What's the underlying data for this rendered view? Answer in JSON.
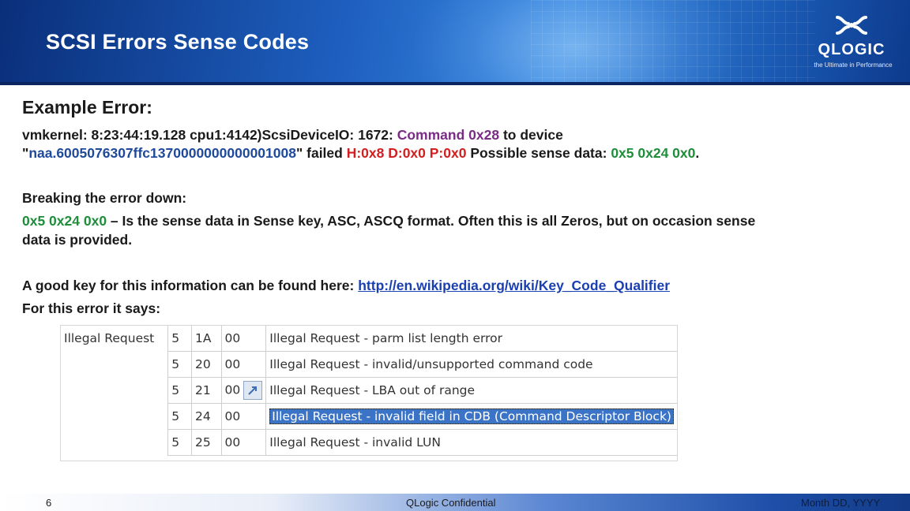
{
  "slide": {
    "title": "SCSI Errors Sense Codes",
    "logo": {
      "word": "QLOGIC",
      "tagline": "the Ultimate in Performance"
    },
    "heading": "Example Error:",
    "error_line1": {
      "prefix": "vmkernel: 8:23:44:19.128 cpu1:4142)ScsiDeviceIO: 1672: ",
      "command": "Command 0x28",
      "suffix": " to device"
    },
    "error_line2": {
      "open_quote": "\"",
      "device": "naa.6005076307ffc1370000000000001008",
      "failed": "\" failed ",
      "hdp": "H:0x8 D:0x0 P:0x0",
      "sense_label": " Possible sense data: ",
      "sense": "0x5 0x24 0x0",
      "end": "."
    },
    "breaking": "Breaking the error down:",
    "explain": {
      "sense": "0x5 0x24 0x0",
      "text1": " – Is the sense data in Sense key, ASC,  ASCQ format.  Often this is all Zeros, but on occasion sense",
      "text2": "data is provided."
    },
    "key_line": {
      "text": "A good key for this information can be found here: ",
      "link": "http://en.wikipedia.org/wiki/Key_Code_Qualifier"
    },
    "says": "For this error it says:",
    "table": {
      "category": "Illegal Request",
      "rows": [
        {
          "sk": "5",
          "asc": "1A",
          "ascq": "00",
          "desc": "Illegal Request - parm list length error"
        },
        {
          "sk": "5",
          "asc": "20",
          "ascq": "00",
          "desc": "Illegal Request - invalid/unsupported command code"
        },
        {
          "sk": "5",
          "asc": "21",
          "ascq": "00",
          "desc": "Illegal Request - LBA out of range"
        },
        {
          "sk": "5",
          "asc": "24",
          "ascq": "00",
          "desc": "Illegal Request - invalid field in CDB (Command Descriptor Block)"
        },
        {
          "sk": "5",
          "asc": "25",
          "ascq": "00",
          "desc": "Illegal Request - invalid LUN"
        }
      ]
    },
    "footer": {
      "page": "6",
      "confidential": "QLogic Confidential",
      "date": "Month DD, YYYY"
    }
  },
  "colors": {
    "header": "#1e5fbf",
    "purple": "#7a2b86",
    "red": "#d21f1f",
    "green": "#1f8e3a",
    "link": "#1a3fb0",
    "selection": "#3b74c7"
  },
  "icons": {
    "logo": "qlogic-logo-icon",
    "paste": "paste-options-icon"
  }
}
